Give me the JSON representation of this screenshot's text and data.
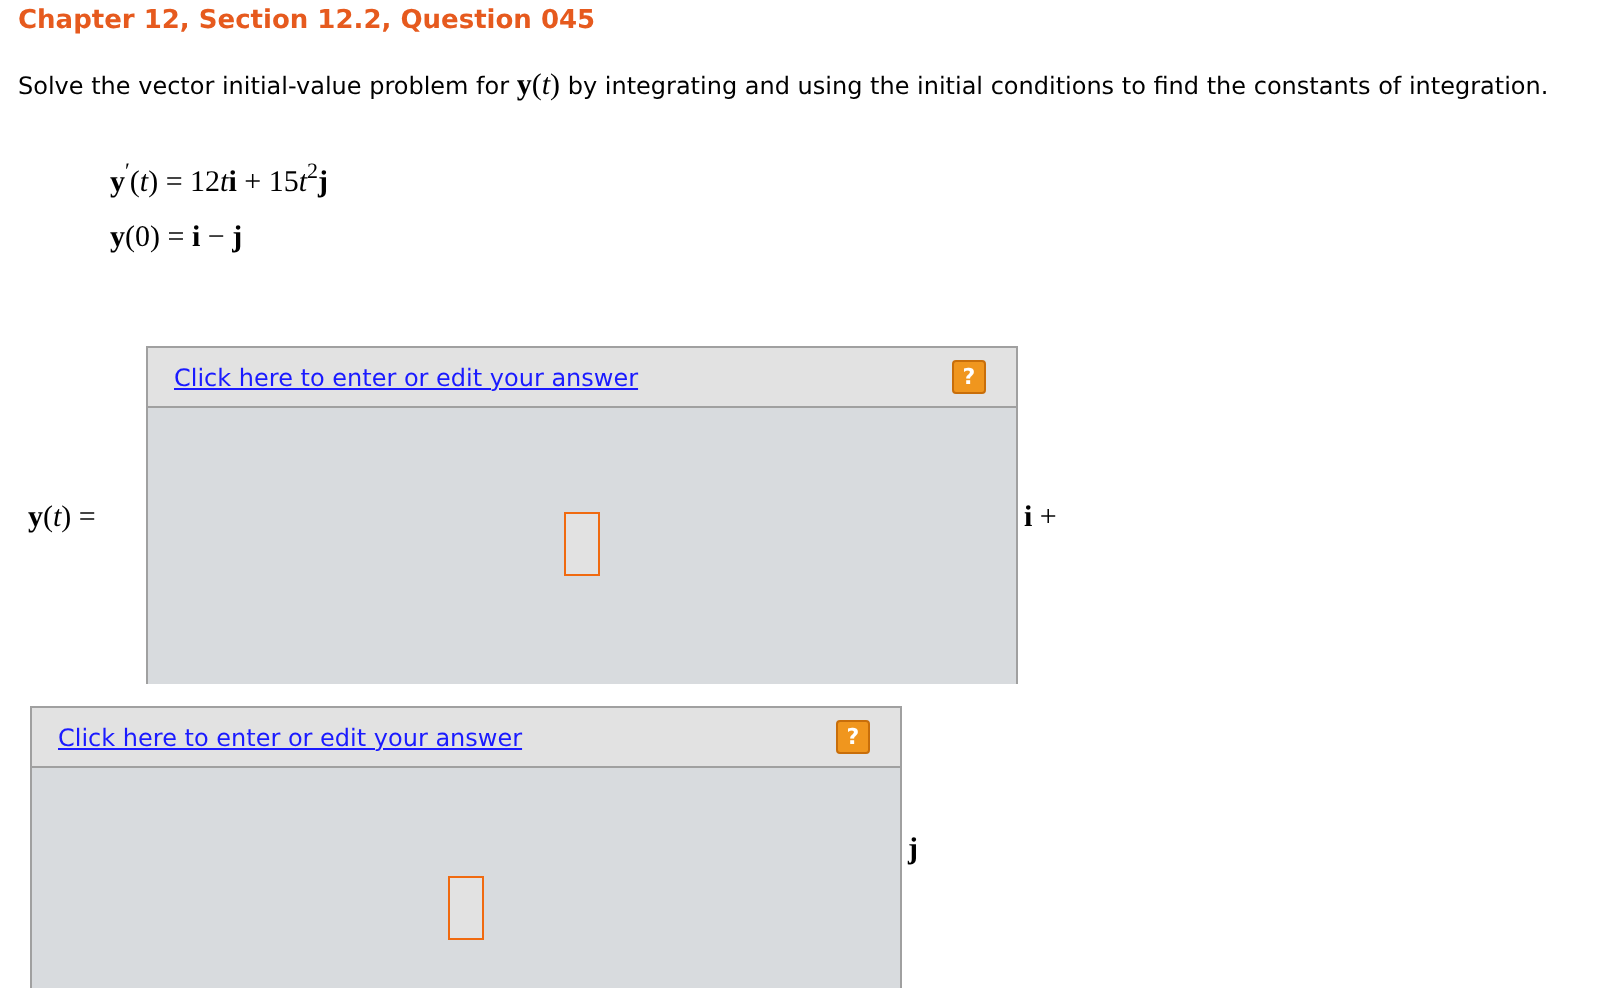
{
  "title": "Chapter 12, Section 12.2, Question 045",
  "prompt": [
    {
      "text": "Solve the vector initial-value problem for ",
      "kind": "plain"
    },
    {
      "text": "y",
      "kind": "mbold"
    },
    {
      "text": "(",
      "kind": "math"
    },
    {
      "text": "t",
      "kind": "mitalic"
    },
    {
      "text": ")",
      "kind": "math"
    },
    {
      "text": " by integrating and using the initial conditions to find the constants of integration.",
      "kind": "plain"
    }
  ],
  "equations": [
    [
      {
        "text": "y",
        "kind": "mbold"
      },
      {
        "text": "′",
        "kind": "sup"
      },
      {
        "text": "(",
        "kind": "math"
      },
      {
        "text": "t",
        "kind": "mitalic"
      },
      {
        "text": ") = 12",
        "kind": "math"
      },
      {
        "text": "t",
        "kind": "mitalic"
      },
      {
        "text": "i",
        "kind": "mbold"
      },
      {
        "text": " + 15",
        "kind": "math"
      },
      {
        "text": "t",
        "kind": "mitalic"
      },
      {
        "text": "2",
        "kind": "sup"
      },
      {
        "text": "j",
        "kind": "mbold"
      }
    ],
    [
      {
        "text": "y",
        "kind": "mbold"
      },
      {
        "text": "(0) = ",
        "kind": "math"
      },
      {
        "text": "i",
        "kind": "mbold"
      },
      {
        "text": " − ",
        "kind": "math"
      },
      {
        "text": "j",
        "kind": "mbold"
      }
    ]
  ],
  "answers": [
    {
      "label": [
        {
          "text": "y",
          "kind": "mbold"
        },
        {
          "text": "(",
          "kind": "math"
        },
        {
          "text": "t",
          "kind": "mitalic"
        },
        {
          "text": ") =",
          "kind": "math"
        }
      ],
      "link": "Click here to enter or edit your answer",
      "help": "?",
      "suffix": [
        {
          "text": "i",
          "kind": "mbold"
        },
        {
          "text": " +",
          "kind": "math"
        }
      ]
    },
    {
      "link": "Click here to enter or edit your answer",
      "help": "?",
      "suffix": [
        {
          "text": "j",
          "kind": "mbold"
        }
      ]
    }
  ]
}
